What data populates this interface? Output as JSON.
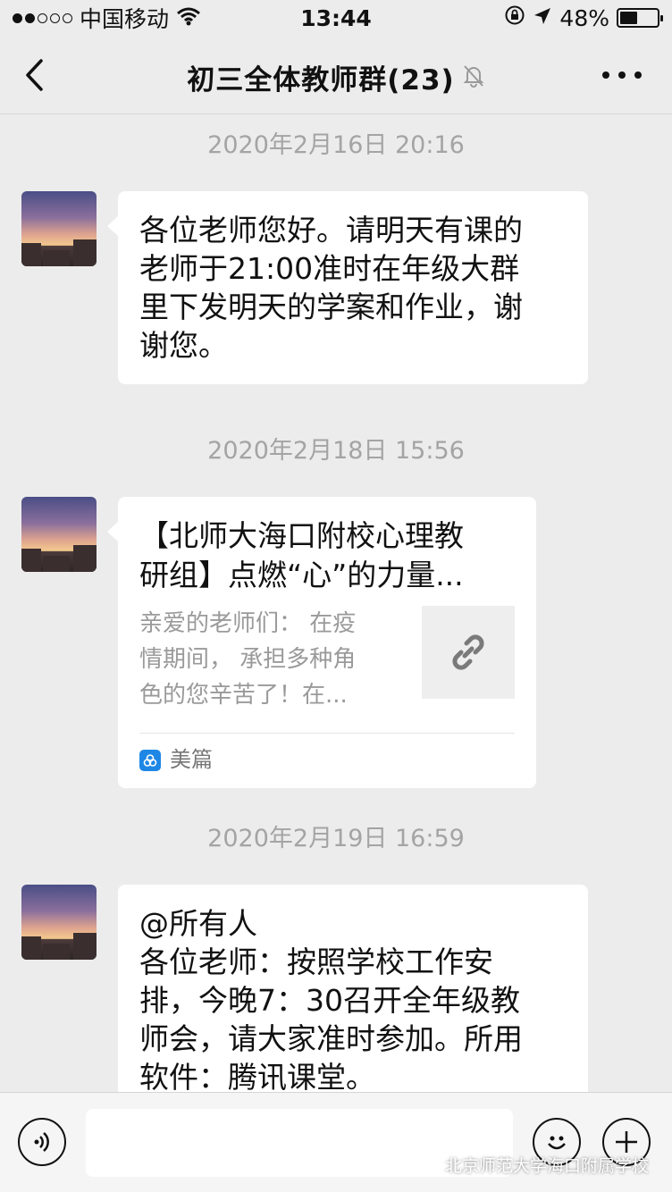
{
  "status_bar": {
    "carrier": "中国移动",
    "time": "13:44",
    "battery": "48%",
    "battery_level": 0.48
  },
  "nav": {
    "title": "初三全体教师群(23)"
  },
  "messages": [
    {
      "timestamp": "2020年2月16日 20:16",
      "text": "各位老师您好。请明天有课的\n老师于21:00准时在年级大群\n里下发明天的学案和作业，谢\n谢您。"
    },
    {
      "timestamp": "2020年2月18日 15:56",
      "link_title": "【北师大海口附校心理教\n研组】点燃“心”的力量...",
      "link_desc": "亲爱的老师们： 在疫\n情期间， 承担多种角\n色的您辛苦了！在...",
      "link_source": "美篇"
    },
    {
      "timestamp": "2020年2月19日 16:59",
      "text": "@所有人\n各位老师：按照学校工作安\n排，今晚7：30召开全年级教\n师会，请大家准时参加。所用\n软件：腾讯课堂。"
    }
  ],
  "watermark": "北京师范大学海口附属学校",
  "colors": {
    "background": "#ececec",
    "timestamp": "#a4a4a4",
    "bubble": "#ffffff",
    "meipian": "#1e87e6"
  }
}
